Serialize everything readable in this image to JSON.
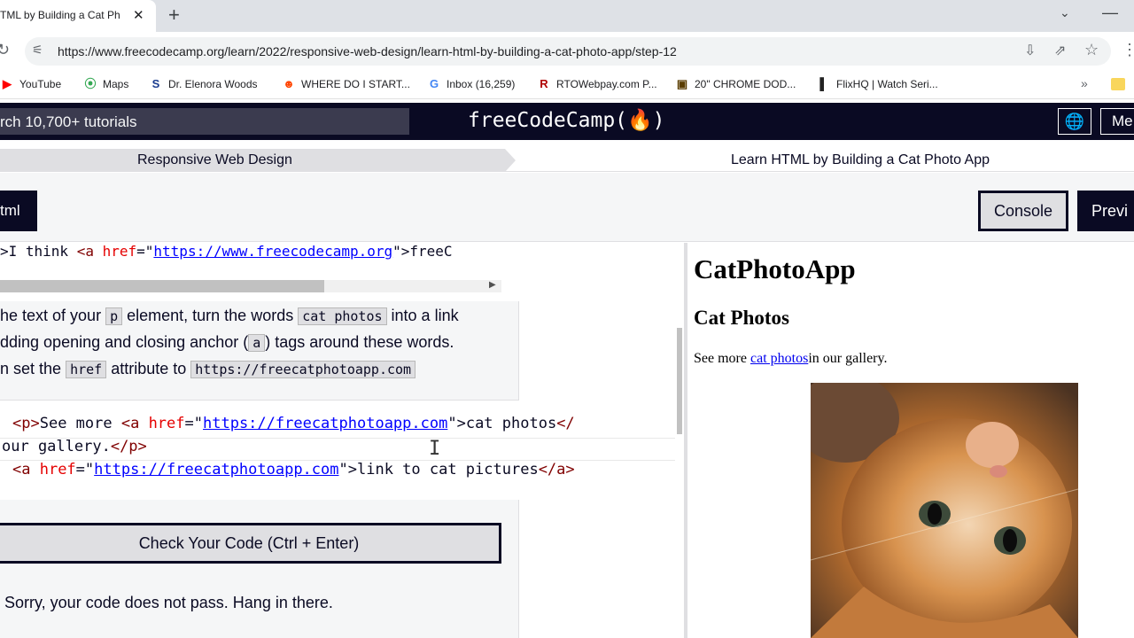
{
  "browser": {
    "tab_title": "TML by Building a Cat Ph",
    "tab_close": "✕",
    "new_tab": "+",
    "tab_dropdown": "⌄",
    "minimize": "—",
    "url": "https://www.freecodecamp.org/learn/2022/responsive-web-design/learn-html-by-building-a-cat-photo-app/step-12",
    "bookmarks": [
      {
        "label": "YouTube",
        "icon": "youtube-icon",
        "color": "#ff0000"
      },
      {
        "label": "Maps",
        "icon": "maps-icon",
        "color": "#34a853"
      },
      {
        "label": "Dr. Elenora Woods",
        "icon": "s-icon",
        "color": "#1a3c8f"
      },
      {
        "label": "WHERE DO I START...",
        "icon": "reddit-icon",
        "color": "#ff4500"
      },
      {
        "label": "Inbox (16,259)",
        "icon": "google-icon",
        "color": "#4285f4"
      },
      {
        "label": "RTOWebpay.com P...",
        "icon": "r-icon",
        "color": "#b00000"
      },
      {
        "label": "20\" CHROME DOD...",
        "icon": "shop-icon",
        "color": "#5a3d00"
      },
      {
        "label": "FlixHQ | Watch Seri...",
        "icon": "flix-icon",
        "color": "#222222"
      }
    ],
    "bookmarks_more": "»"
  },
  "fcc": {
    "search_text": "rch 10,700+ tutorials",
    "logo": "freeCodeCamp(🔥)",
    "menu_label": "Me"
  },
  "breadcrumb": {
    "superblock": "Responsive Web Design",
    "block": "Learn HTML by Building a Cat Photo App"
  },
  "toolbar": {
    "file_tab": "tml",
    "console": "Console",
    "preview": "Previ"
  },
  "editor": {
    "top_line_prefix": ">I think ",
    "top_line_tag": "<a ",
    "top_line_attr": "href",
    "top_line_eq": "=\"",
    "top_line_url": "https://www.freecodecamp.org",
    "top_line_end": "\">freeC",
    "instructions": {
      "l1a": "he text of your ",
      "l1_code1": "p",
      "l1b": " element, turn the words ",
      "l1_code2": "cat photos",
      "l1c": " into a link",
      "l2a": "dding opening and closing anchor (",
      "l2_code": "a",
      "l2b": ") tags around these words.",
      "l3a": "n set the ",
      "l3_code1": "href",
      "l3b": " attribute to ",
      "l3_code2": "https://freecatphotoapp.com"
    },
    "line1": {
      "open_p": "<p>",
      "text1": "See more ",
      "a_open": "<a ",
      "attr": "href",
      "eq": "=\"",
      "url": "https://freecatphotoapp.com",
      "close_q": "\">",
      "text2": "cat photos",
      "close_a": "</"
    },
    "line2": {
      "text": "our gallery.",
      "close_p": "</p>"
    },
    "line3": {
      "a_open": "<a ",
      "attr": "href",
      "eq": "=\"",
      "url": "https://freecatphotoapp.com",
      "close_q": "\">",
      "text": "link to cat pictures",
      "close_a": "</a>"
    },
    "check_button": "Check Your Code (Ctrl + Enter)",
    "fail_message": "Sorry, your code does not pass. Hang in there."
  },
  "preview": {
    "h1": "CatPhotoApp",
    "h2": "Cat Photos",
    "p_before": "See more ",
    "p_link": "cat photos",
    "p_after": "in our gallery."
  }
}
